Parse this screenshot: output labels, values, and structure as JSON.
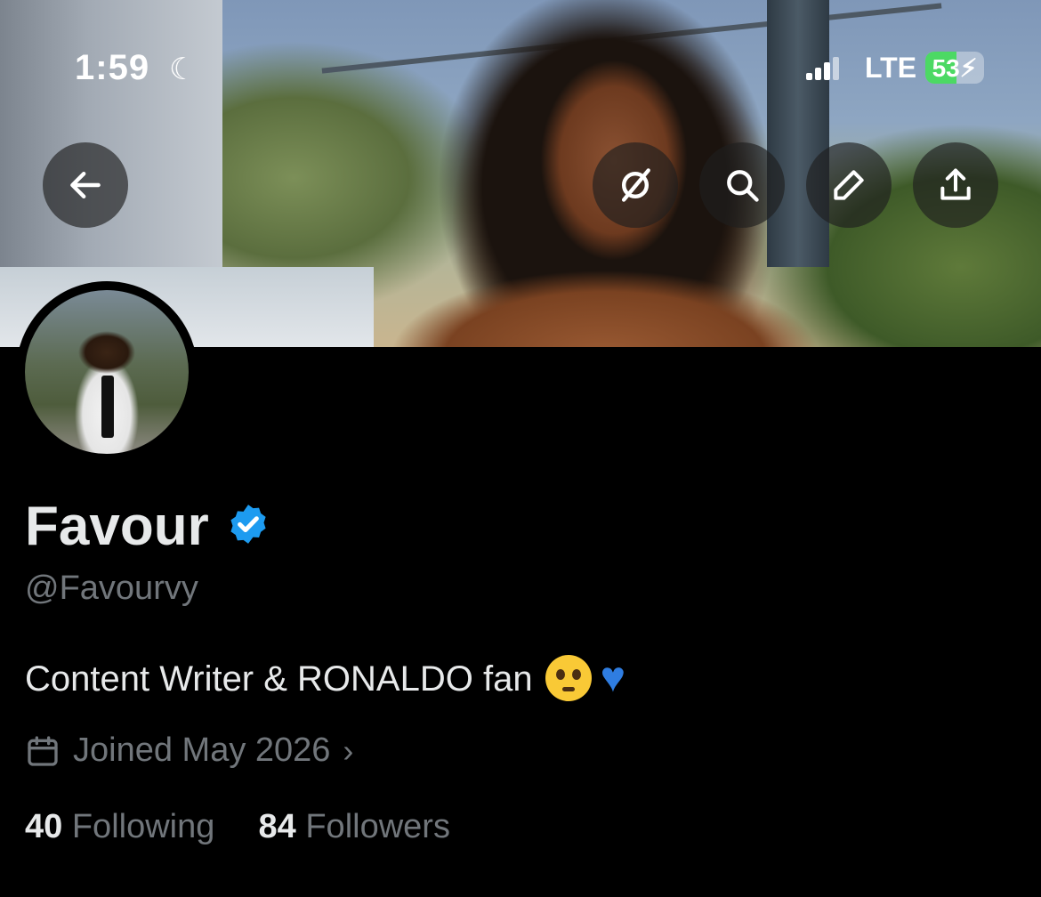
{
  "status_bar": {
    "time": "1:59",
    "network": "LTE",
    "battery": "53",
    "battery_level": 0.53
  },
  "header_buttons": {
    "back": "arrow-left-icon",
    "grok": "grok-icon",
    "search": "search-icon",
    "edit": "pencil-icon",
    "share": "share-icon"
  },
  "profile": {
    "name": "Favour",
    "handle": "@Favourvy",
    "bio": "Content Writer & RONALDO fan",
    "joined": "Joined May 2026",
    "following_count": "40",
    "following_label": "Following",
    "followers_count": "84",
    "followers_label": "Followers"
  },
  "colors": {
    "background": "#000000",
    "primary_text": "#e7e9ea",
    "secondary_text": "#71767b",
    "verified": "#1d9bf0"
  }
}
